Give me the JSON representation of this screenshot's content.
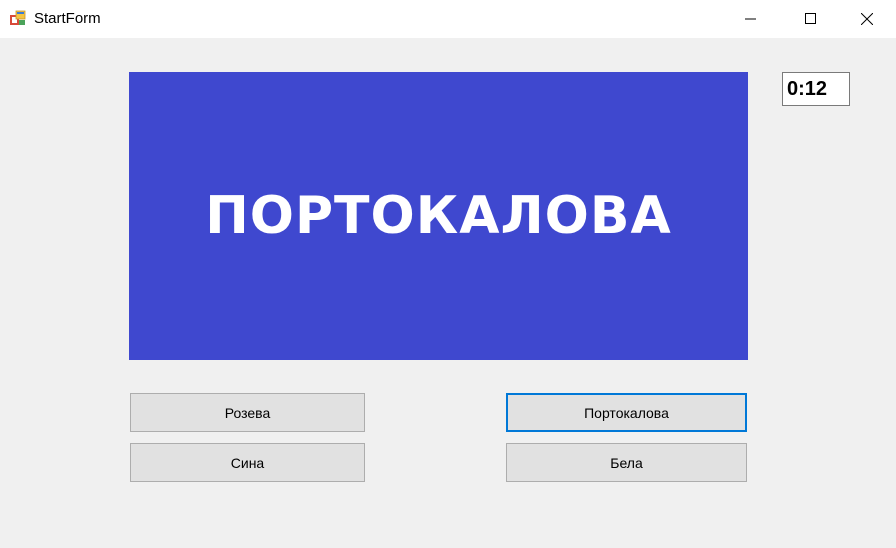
{
  "window": {
    "title": "StartForm",
    "icons": {
      "app": "app-form-icon",
      "minimize": "minimize-icon",
      "maximize": "maximize-icon",
      "close": "close-icon"
    }
  },
  "game": {
    "word": "ПОРТОКАЛОВА",
    "word_color": "#ffffff",
    "panel_color": "#3f48cf",
    "timer": "0:12",
    "answers": [
      {
        "label": "Розева"
      },
      {
        "label": "Портокалова",
        "focused": true
      },
      {
        "label": "Сина"
      },
      {
        "label": "Бела"
      }
    ]
  }
}
